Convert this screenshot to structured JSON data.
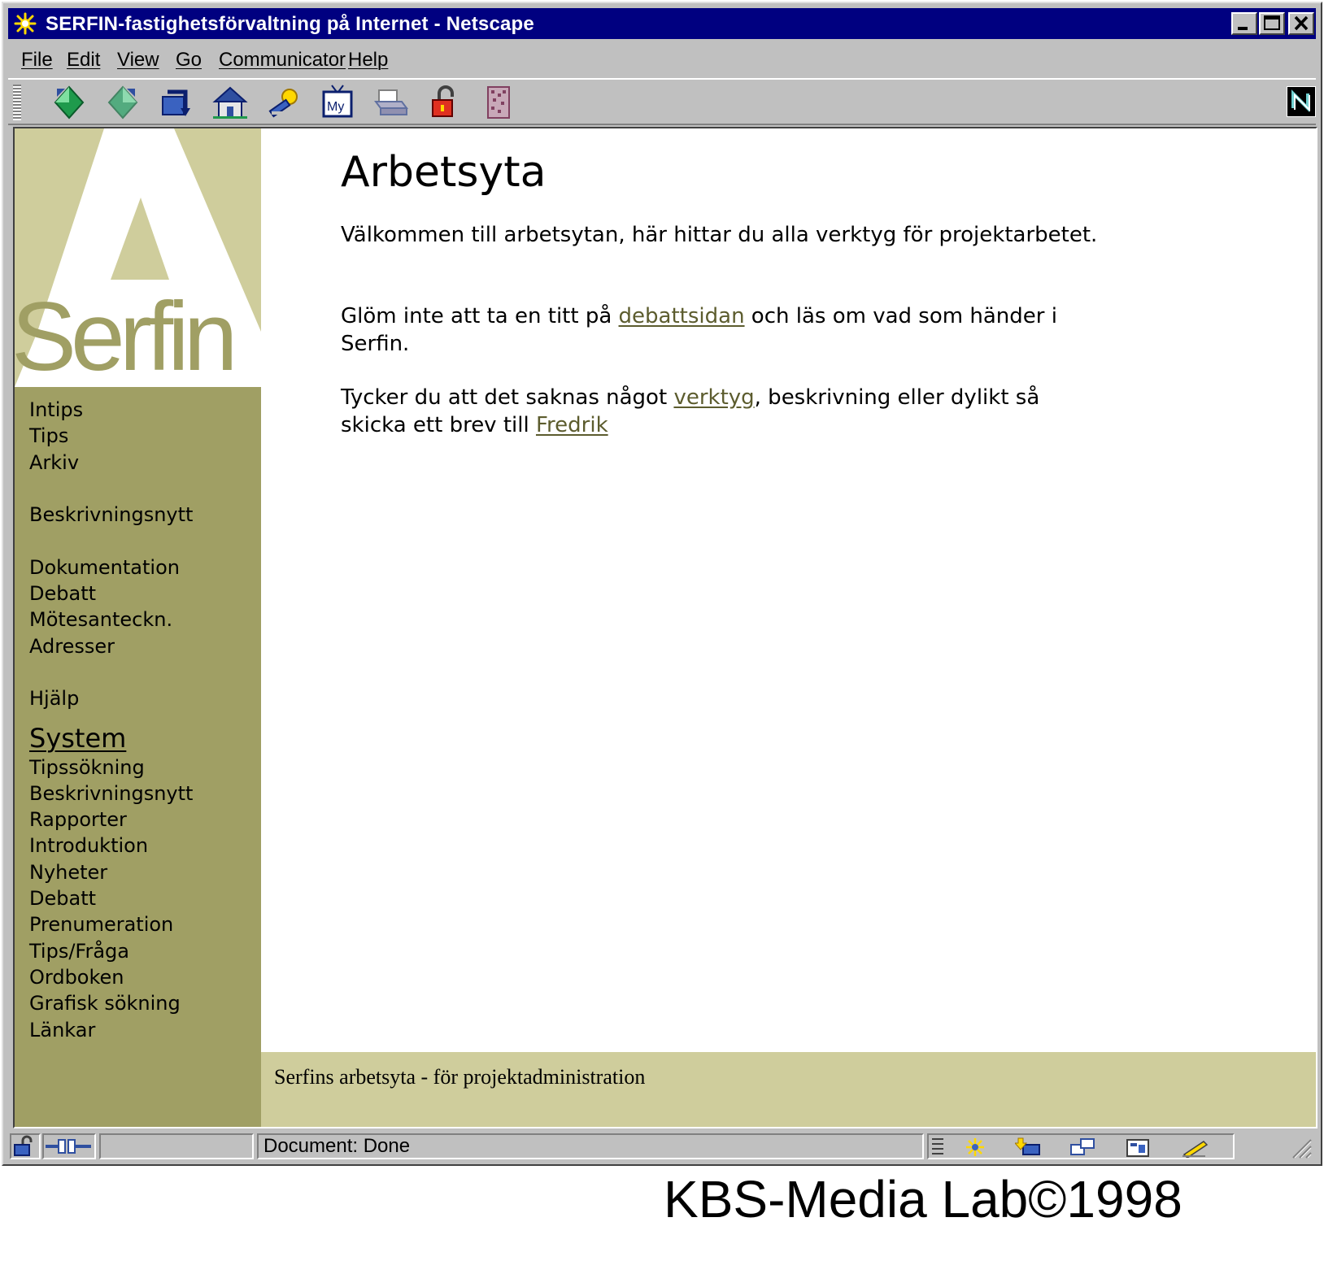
{
  "window": {
    "title": "SERFIN-fastighetsförvaltning på Internet - Netscape",
    "controls": [
      "minimize",
      "maximize",
      "close"
    ]
  },
  "menu": {
    "items": [
      {
        "label": "File"
      },
      {
        "label": "Edit"
      },
      {
        "label": "View"
      },
      {
        "label": "Go"
      },
      {
        "label": "Communicator"
      },
      {
        "label": "Help"
      }
    ]
  },
  "toolbar": {
    "icons": [
      "back-icon",
      "forward-icon",
      "reload-icon",
      "home-icon",
      "search-icon",
      "my-netscape-icon",
      "print-icon",
      "security-icon",
      "stop-icon"
    ],
    "my_label": "My"
  },
  "sidebar": {
    "logo_word": "Serfin",
    "logo_letter": "A",
    "nav": [
      {
        "label": "Intips"
      },
      {
        "label": "Tips"
      },
      {
        "label": "Arkiv"
      },
      {
        "label": "Beskrivningsnytt"
      },
      {
        "label": "Dokumentation"
      },
      {
        "label": "Debatt"
      },
      {
        "label": "Mötesanteckn."
      },
      {
        "label": "Adresser"
      },
      {
        "label": "Hjälp"
      }
    ],
    "system_heading": "System",
    "system_nav": [
      {
        "label": "Tipssökning"
      },
      {
        "label": "Beskrivningsnytt"
      },
      {
        "label": "Rapporter"
      },
      {
        "label": "Introduktion"
      },
      {
        "label": "Nyheter"
      },
      {
        "label": "Debatt"
      },
      {
        "label": "Prenumeration"
      },
      {
        "label": "Tips/Fråga"
      },
      {
        "label": "Ordboken"
      },
      {
        "label": "Grafisk sökning"
      },
      {
        "label": "Länkar"
      }
    ]
  },
  "main": {
    "title": "Arbetsyta",
    "p1": "Välkommen till arbetsytan, här hittar du alla verktyg för projektarbetet.",
    "p2_before": "Glöm inte att ta en titt på ",
    "p2_link": "debattsidan",
    "p2_after": " och läs om vad som händer i Serfin.",
    "p3_before": "Tycker du att det saknas något ",
    "p3_link": "verktyg",
    "p3_middle": ", beskrivning eller dylikt så skicka ett brev till ",
    "p3_link2": "Fredrik",
    "footer": "Serfins arbetsyta - för projektadministration"
  },
  "statusbar": {
    "message": "Document: Done"
  },
  "colors": {
    "titlebar": "#000080",
    "sidebar": "#a09f64",
    "logo_bg": "#cfcd9c",
    "link": "#5c5c2e"
  },
  "credit": "KBS-Media Lab©1998"
}
